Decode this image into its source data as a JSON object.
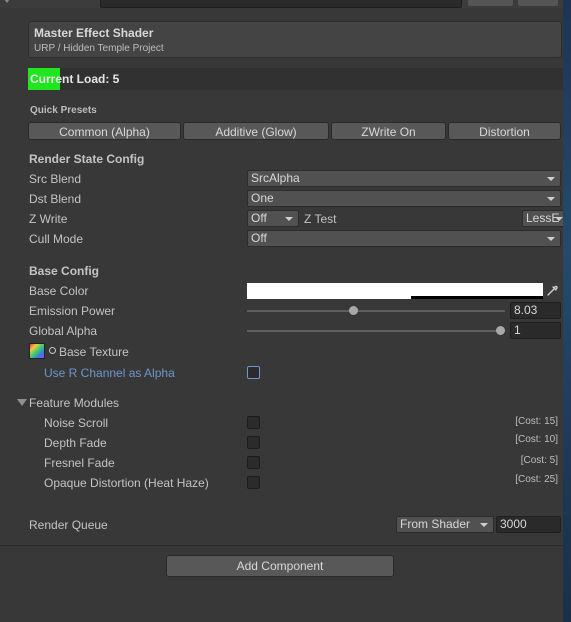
{
  "header": {
    "title": "Master Effect Shader",
    "subtitle": "URP / Hidden Temple Project"
  },
  "load": {
    "label": "Current Load: 5",
    "bar_fraction": 0.06
  },
  "presets": {
    "title": "Quick Presets",
    "buttons": [
      "Common (Alpha)",
      "Additive (Glow)",
      "ZWrite On",
      "Distortion"
    ]
  },
  "render_state": {
    "title": "Render State Config",
    "src_blend": {
      "label": "Src Blend",
      "value": "SrcAlpha"
    },
    "dst_blend": {
      "label": "Dst Blend",
      "value": "One"
    },
    "z_write": {
      "label": "Z Write",
      "value": "Off"
    },
    "z_test": {
      "label": "Z Test",
      "value": "LessE"
    },
    "cull_mode": {
      "label": "Cull Mode",
      "value": "Off"
    }
  },
  "base_config": {
    "title": "Base Config",
    "base_color": {
      "label": "Base Color",
      "value": "#ffffff"
    },
    "emission_power": {
      "label": "Emission Power",
      "value": "8.03",
      "slider_fraction": 0.41
    },
    "global_alpha": {
      "label": "Global Alpha",
      "value": "1",
      "slider_fraction": 1.0
    },
    "base_texture": {
      "label": "Base Texture"
    },
    "use_r_channel": {
      "label": "Use R Channel as Alpha",
      "checked": false
    }
  },
  "features": {
    "title": "Feature Modules",
    "items": [
      {
        "label": "Noise Scroll",
        "cost": "[Cost: 15]",
        "checked": false
      },
      {
        "label": "Depth Fade",
        "cost": "[Cost: 10]",
        "checked": false
      },
      {
        "label": "Fresnel Fade",
        "cost": "[Cost: 5]",
        "checked": false
      },
      {
        "label": "Opaque Distortion (Heat Haze)",
        "cost": "[Cost: 25]",
        "checked": false
      }
    ]
  },
  "render_queue": {
    "label": "Render Queue",
    "mode": "From Shader",
    "value": "3000"
  },
  "footer": {
    "add_component": "Add Component"
  },
  "colors": {
    "accent_load": "#1fe61f",
    "link_blue": "#6d96cc",
    "panel_bg": "#383838"
  }
}
